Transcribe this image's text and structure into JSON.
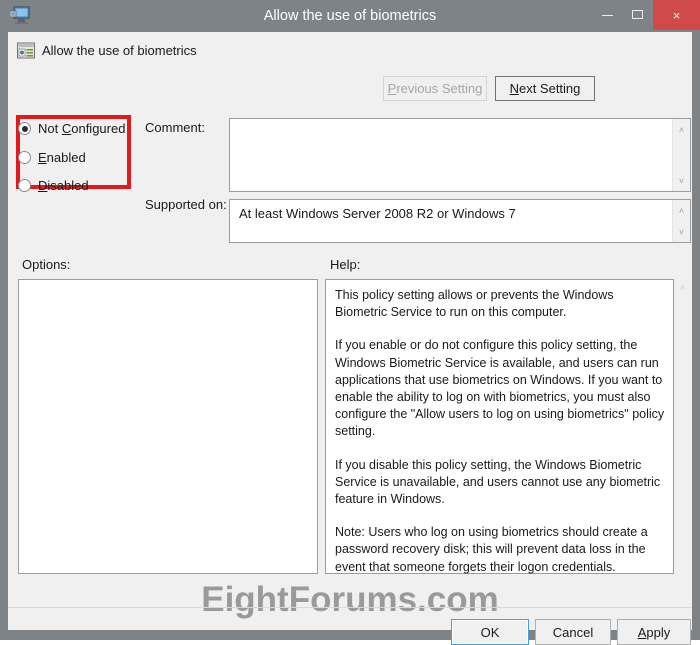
{
  "window": {
    "title": "Allow the use of biometrics",
    "app_icon": "computer-monitor-icon",
    "controls": {
      "minimize": "minimize-icon",
      "maximize": "maximize-icon",
      "close": "×"
    }
  },
  "header": {
    "policy_icon": "policy-setting-icon",
    "policy_name": "Allow the use of biometrics",
    "previous_button": "Previous Setting",
    "previous_accel": "P",
    "previous_disabled": true,
    "next_button": "Next Setting",
    "next_accel": "N"
  },
  "state_options": {
    "selected": "Not Configured",
    "highlight_color": "#e01b1b",
    "items": [
      {
        "label_before": "Not ",
        "accel": "C",
        "label_after": "onfigured",
        "checked": true
      },
      {
        "label_before": "",
        "accel": "E",
        "label_after": "nabled",
        "checked": false
      },
      {
        "label_before": "",
        "accel": "D",
        "label_after": "isabled",
        "checked": false
      }
    ]
  },
  "fields": {
    "comment_label": "Comment:",
    "comment_value": "",
    "comment_placeholder": "",
    "supported_label": "Supported on:",
    "supported_value": "At least Windows Server 2008 R2 or Windows 7"
  },
  "panels": {
    "options_label": "Options:",
    "options_content": "",
    "help_label": "Help:",
    "help_paragraphs": [
      "This policy setting allows or prevents the Windows Biometric Service to run on this computer.",
      "If you enable or do not configure this policy setting, the Windows Biometric Service is available, and users can run applications that use biometrics on Windows. If you want to enable the ability to log on with biometrics, you must also configure the \"Allow users to log on using biometrics\" policy setting.",
      "If you disable this policy setting, the Windows Biometric Service is unavailable, and users cannot use any biometric feature in Windows.",
      "Note: Users who log on using biometrics should create a password recovery disk; this will prevent data loss in the event that someone forgets their logon credentials."
    ]
  },
  "watermark": {
    "text": "EightForums.com"
  },
  "footer": {
    "ok": "OK",
    "cancel": "Cancel",
    "apply_before": "",
    "apply_accel": "A",
    "apply_after": "pply"
  },
  "icons": {
    "scroll_up": "˄",
    "scroll_down": "˅"
  }
}
